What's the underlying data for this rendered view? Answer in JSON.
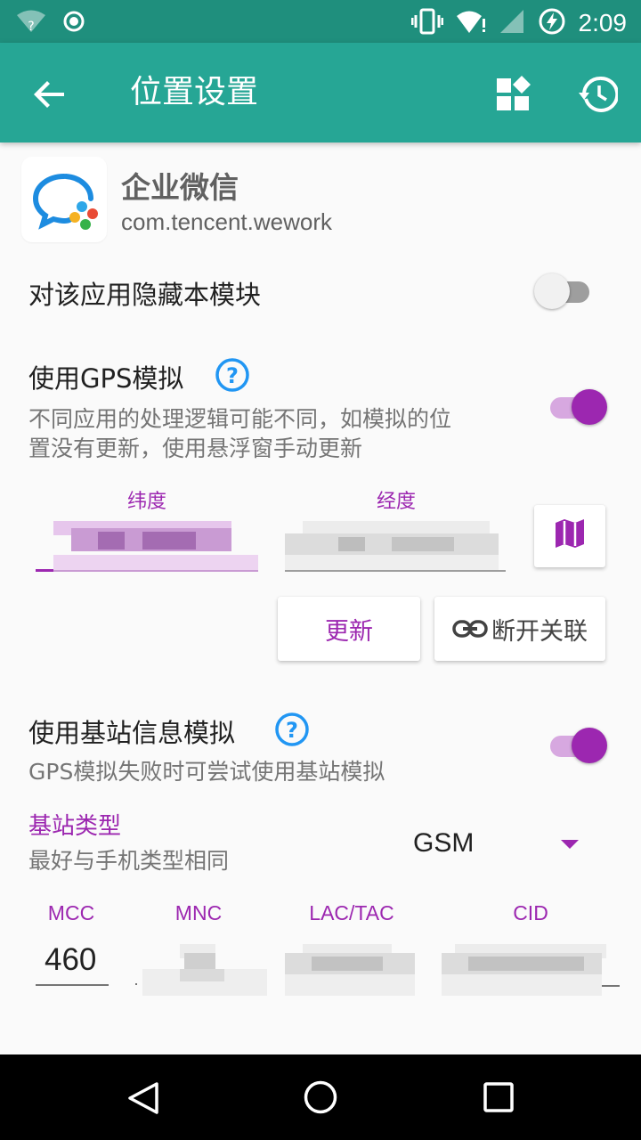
{
  "status_bar": {
    "time": "2:09",
    "icons": [
      "wifi-question-icon",
      "target-icon",
      "vibrate-icon",
      "wifi-alert-icon",
      "signal-icon",
      "battery-charging-icon"
    ]
  },
  "app_bar": {
    "title": "位置设置",
    "back_icon": "arrow-back-icon",
    "actions": [
      "widgets-icon",
      "history-icon"
    ]
  },
  "app_info": {
    "name": "企业微信",
    "package": "com.tencent.wework"
  },
  "hide_module": {
    "label": "对该应用隐藏本模块",
    "enabled": false
  },
  "gps": {
    "label": "使用GPS模拟",
    "description_line1": "不同应用的处理逻辑可能不同，如模拟的位",
    "description_line2": "置没有更新，使用悬浮窗手动更新",
    "enabled": true,
    "latitude_label": "纬度",
    "longitude_label": "经度",
    "map_icon": "map-icon",
    "update_button": "更新",
    "unlink_button": "断开关联",
    "unlink_icon": "link-icon"
  },
  "cell": {
    "label": "使用基站信息模拟",
    "description": "GPS模拟失败时可尝试使用基站模拟",
    "enabled": true,
    "type_label": "基站类型",
    "type_hint": "最好与手机类型相同",
    "type_value": "GSM",
    "columns": [
      "MCC",
      "MNC",
      "LAC/TAC",
      "CID"
    ],
    "mcc_value": "460"
  },
  "colors": {
    "status_bar": "#1f8f7d",
    "app_bar": "#26a695",
    "accent": "#9c27b0",
    "help": "#2196f3"
  },
  "nav_bar": {
    "icons": [
      "back-triangle-icon",
      "home-circle-icon",
      "recents-square-icon"
    ]
  }
}
